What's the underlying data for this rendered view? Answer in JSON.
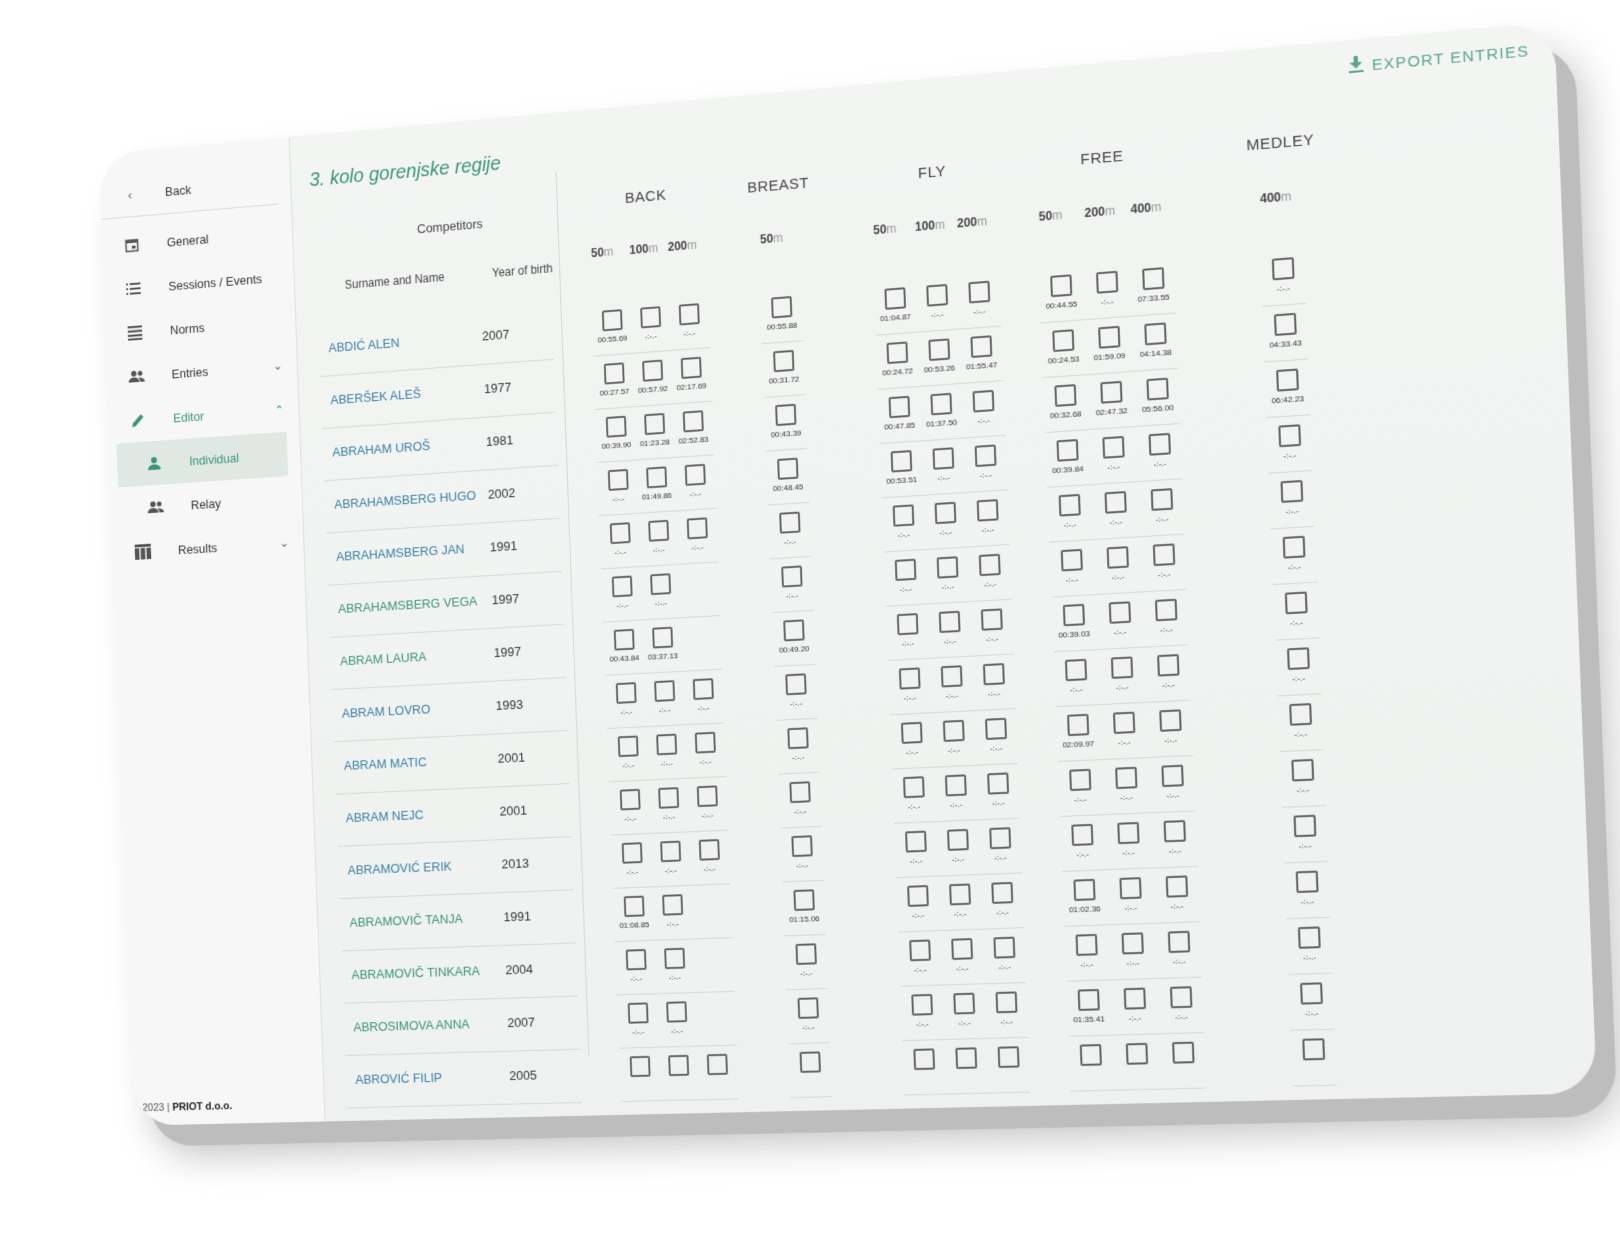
{
  "sidebar": {
    "back": "Back",
    "items": [
      {
        "label": "General"
      },
      {
        "label": "Sessions / Events"
      },
      {
        "label": "Norms"
      },
      {
        "label": "Entries"
      },
      {
        "label": "Editor"
      },
      {
        "label": "Individual"
      },
      {
        "label": "Relay"
      },
      {
        "label": "Results"
      }
    ],
    "footer_year": "2023 |",
    "footer_company": "PRIOT d.o.o."
  },
  "header": {
    "title": "3. kolo gorenjske regije",
    "export": "EXPORT ENTRIES"
  },
  "columns": {
    "competitors": "Competitors",
    "name_col": "Surname and Name",
    "year_col": "Year of birth",
    "strokes": [
      "BACK",
      "BREAST",
      "FLY",
      "FREE",
      "MEDLEY"
    ],
    "back_dists": [
      "50",
      "100",
      "200"
    ],
    "breast_dists": [
      "50"
    ],
    "fly_dists": [
      "50",
      "100",
      "200"
    ],
    "free_dists": [
      "50",
      "200",
      "400"
    ],
    "medley_dists": [
      "400"
    ],
    "unit": "m"
  },
  "rows": [
    {
      "name": "ABDIĆ ALEN",
      "year": "2007",
      "back": [
        "00:55.69",
        "-:-.-",
        "-:-.-"
      ],
      "breast": [
        "00:55.88"
      ],
      "fly": [
        "01:04.87",
        "-:-.-",
        "-:-.-"
      ],
      "free": [
        "00:44.55",
        "-:-.-",
        "07:33.55"
      ],
      "medley": [
        "-:-.-"
      ]
    },
    {
      "name": "ABERŠEK ALEŠ",
      "year": "1977",
      "back": [
        "00:27.57",
        "00:57.92",
        "02:17.69"
      ],
      "breast": [
        "00:31.72"
      ],
      "fly": [
        "00:24.72",
        "00:53.26",
        "01:55.47"
      ],
      "free": [
        "00:24.53",
        "01:59.09",
        "04:14.38"
      ],
      "medley": [
        "04:33.43"
      ]
    },
    {
      "name": "ABRAHAM UROŠ",
      "year": "1981",
      "back": [
        "00:39.90",
        "01:23.28",
        "02:52.83"
      ],
      "breast": [
        "00:43.39"
      ],
      "fly": [
        "00:47.85",
        "01:37.50",
        "-:-.-"
      ],
      "free": [
        "00:32.68",
        "02:47.32",
        "05:56.00"
      ],
      "medley": [
        "06:42.23"
      ]
    },
    {
      "name": "ABRAHAMSBERG HUGO",
      "year": "2002",
      "back": [
        "-:-.-",
        "01:49.86",
        "-:-.-"
      ],
      "breast": [
        "00:48.45"
      ],
      "fly": [
        "00:53.51",
        "-:-.-",
        "-:-.-"
      ],
      "free": [
        "00:39.84",
        "-:-.-",
        "-:-.-"
      ],
      "medley": [
        "-:-.-"
      ]
    },
    {
      "name": "ABRAHAMSBERG JAN",
      "year": "1991",
      "back": [
        "-:-.-",
        "-:-.-",
        "-:-.-"
      ],
      "breast": [
        "-:-.-"
      ],
      "fly": [
        "-:-.-",
        "-:-.-",
        "-:-.-"
      ],
      "free": [
        "-:-.-",
        "-:-.-",
        "-:-.-"
      ],
      "medley": [
        "-:-.-"
      ]
    },
    {
      "name": "ABRAHAMSBERG VEGA",
      "year": "1997",
      "back": [
        "-:-.-",
        "-:-.-"
      ],
      "breast": [
        "-:-.-"
      ],
      "fly": [
        "-:-.-",
        "-:-.-",
        "-:-.-"
      ],
      "free": [
        "-:-.-",
        "-:-.-",
        "-:-.-"
      ],
      "medley": [
        "-:-.-"
      ]
    },
    {
      "name": "ABRAM LAURA",
      "year": "1997",
      "back": [
        "00:43.84",
        "03:37.13"
      ],
      "breast": [
        "00:49.20"
      ],
      "fly": [
        "-:-.-",
        "-:-.-",
        "-:-.-"
      ],
      "free": [
        "00:39.03",
        "-:-.-",
        "-:-.-"
      ],
      "medley": [
        "-:-.-"
      ]
    },
    {
      "name": "ABRAM LOVRO",
      "year": "1993",
      "back": [
        "-:-.-",
        "-:-.-",
        "-:-.-"
      ],
      "breast": [
        "-:-.-"
      ],
      "fly": [
        "-:-.-",
        "-:-.-",
        "-:-.-"
      ],
      "free": [
        "-:-.-",
        "-:-.-",
        "-:-.-"
      ],
      "medley": [
        "-:-.-"
      ]
    },
    {
      "name": "ABRAM MATIC",
      "year": "2001",
      "back": [
        "-:-.-",
        "-:-.-",
        "-:-.-"
      ],
      "breast": [
        "-:-.-"
      ],
      "fly": [
        "-:-.-",
        "-:-.-",
        "-:-.-"
      ],
      "free": [
        "02:09.97",
        "-:-.-",
        "-:-.-"
      ],
      "medley": [
        "-:-.-"
      ]
    },
    {
      "name": "ABRAM NEJC",
      "year": "2001",
      "back": [
        "-:-.-",
        "-:-.-",
        "-:-.-"
      ],
      "breast": [
        "-:-.-"
      ],
      "fly": [
        "-:-.-",
        "-:-.-",
        "-:-.-"
      ],
      "free": [
        "-:-.-",
        "-:-.-",
        "-:-.-"
      ],
      "medley": [
        "-:-.-"
      ]
    },
    {
      "name": "ABRAMOVIĆ ERIK",
      "year": "2013",
      "back": [
        "-:-.-",
        "-:-.-",
        "-:-.-"
      ],
      "breast": [
        "-:-.-"
      ],
      "fly": [
        "-:-.-",
        "-:-.-",
        "-:-.-"
      ],
      "free": [
        "-:-.-",
        "-:-.-",
        "-:-.-"
      ],
      "medley": [
        "-:-.-"
      ]
    },
    {
      "name": "ABRAMOVIČ TANJA",
      "year": "1991",
      "back": [
        "01:08.85",
        "-:-.-"
      ],
      "breast": [
        "01:15.06"
      ],
      "fly": [
        "-:-.-",
        "-:-.-",
        "-:-.-"
      ],
      "free": [
        "01:02.36",
        "-:-.-",
        "-:-.-"
      ],
      "medley": [
        "-:-.-"
      ]
    },
    {
      "name": "ABRAMOVIČ TINKARA",
      "year": "2004",
      "back": [
        "-:-.-",
        "-:-.-"
      ],
      "breast": [
        "-:-.-"
      ],
      "fly": [
        "-:-.-",
        "-:-.-",
        "-:-.-"
      ],
      "free": [
        "-:-.-",
        "-:-.-",
        "-:-.-"
      ],
      "medley": [
        "-:-.-"
      ]
    },
    {
      "name": "ABROSIMOVA ANNA",
      "year": "2007",
      "back": [
        "-:-.-",
        "-:-.-"
      ],
      "breast": [
        "-:-.-"
      ],
      "fly": [
        "-:-.-",
        "-:-.-",
        "-:-.-"
      ],
      "free": [
        "01:35.41",
        "-:-.-",
        "-:-.-"
      ],
      "medley": [
        "-:-.-"
      ]
    },
    {
      "name": "ABROVIĆ FILIP",
      "year": "2005",
      "back": [
        "",
        "",
        ""
      ],
      "breast": [
        ""
      ],
      "fly": [
        "",
        "",
        ""
      ],
      "free": [
        "",
        "",
        ""
      ],
      "medley": [
        ""
      ]
    }
  ],
  "green_names": [
    "ABRAHAMSBERG VEGA",
    "ABRAM LAURA",
    "ABRAMOVIČ TANJA",
    "ABRAMOVIČ TINKARA",
    "ABROSIMOVA ANNA"
  ],
  "colors": {
    "accent": "#3a9479",
    "name": "#3a7fa9"
  }
}
